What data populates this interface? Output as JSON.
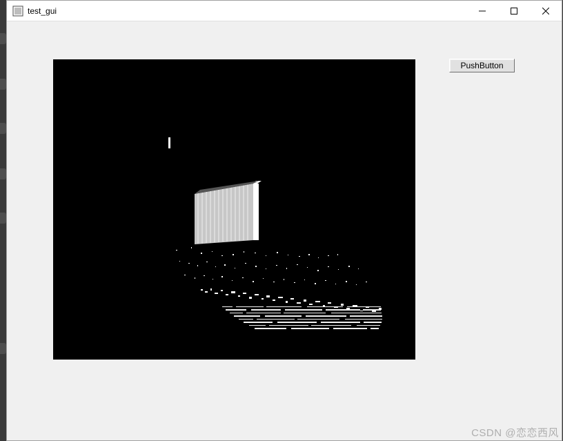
{
  "window": {
    "title": "test_gui"
  },
  "button": {
    "label": "PushButton"
  },
  "watermark": {
    "text": "CSDN @恋恋西风"
  }
}
